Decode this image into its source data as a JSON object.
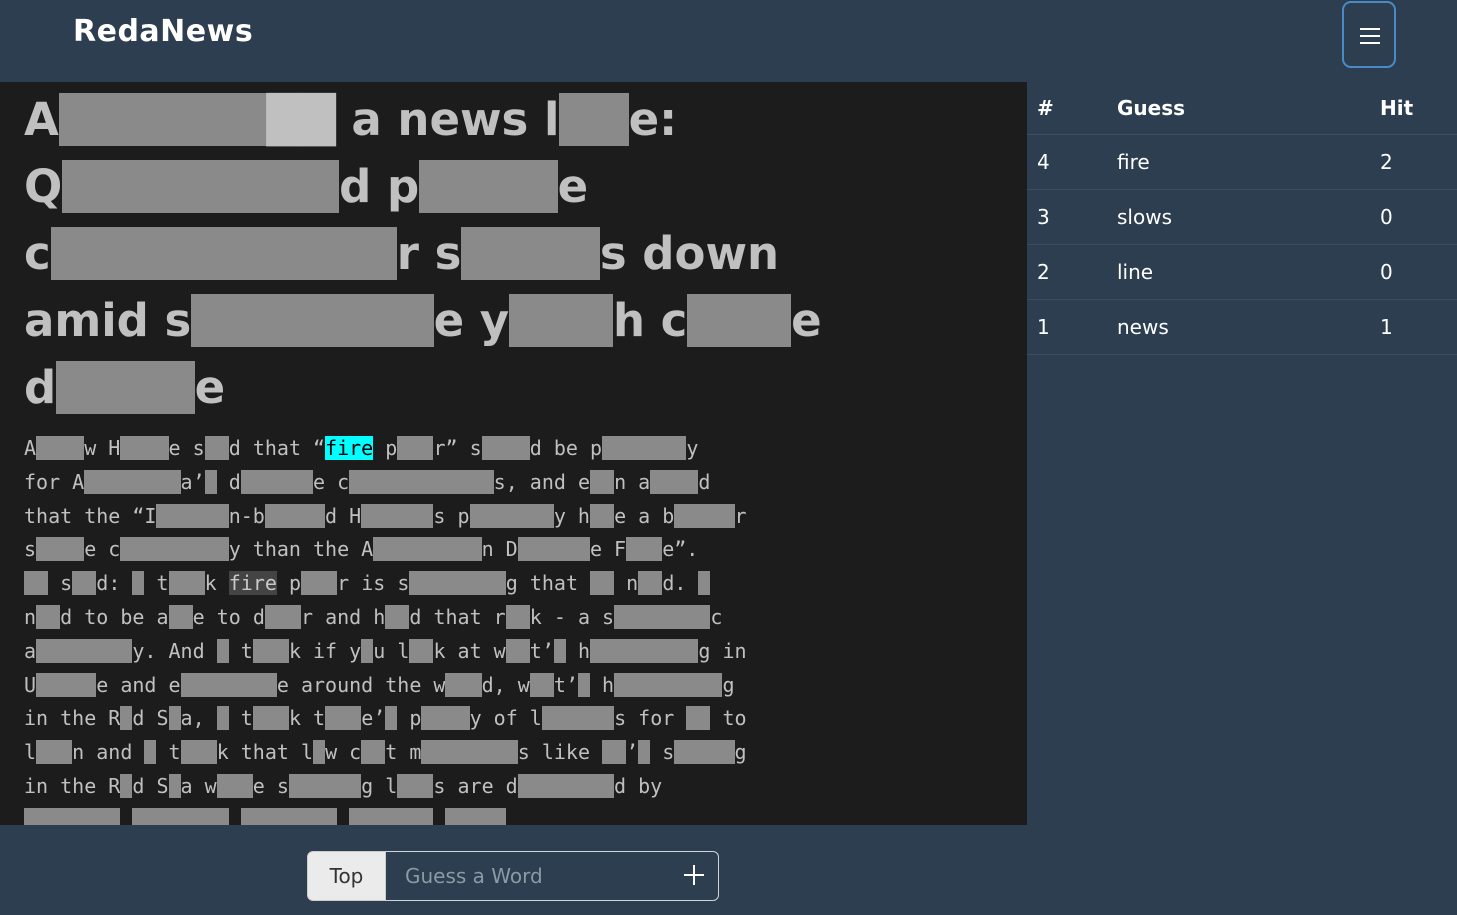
{
  "navbar": {
    "brand": "RedaNews",
    "menu_icon": "hamburger-icon"
  },
  "article": {
    "title_segments": [
      {
        "t": "A"
      },
      {
        "r": "██████"
      },
      {
        "t": "██"
      },
      {
        "t": " a news l"
      },
      {
        "r": "██"
      },
      {
        "t": "e:"
      },
      {
        "br": true
      },
      {
        "t": "Q"
      },
      {
        "r": "████████"
      },
      {
        "t": "d p"
      },
      {
        "r": "████"
      },
      {
        "t": "e"
      },
      {
        "br": true
      },
      {
        "t": "c"
      },
      {
        "r": "██████████"
      },
      {
        "t": "r s"
      },
      {
        "r": "████"
      },
      {
        "t": "s down"
      },
      {
        "br": true
      },
      {
        "t": "amid s"
      },
      {
        "r": "███████"
      },
      {
        "t": "e y"
      },
      {
        "r": "███"
      },
      {
        "t": "h c"
      },
      {
        "r": "███"
      },
      {
        "t": "e"
      },
      {
        "br": true
      },
      {
        "t": "d"
      },
      {
        "r": "████"
      },
      {
        "t": "e"
      }
    ],
    "body_segments": [
      {
        "t": "A"
      },
      {
        "r": "████"
      },
      {
        "t": "w H"
      },
      {
        "r": "████"
      },
      {
        "t": "e s"
      },
      {
        "r": "██"
      },
      {
        "t": "d that “"
      },
      {
        "hit": "fire"
      },
      {
        "t": " p"
      },
      {
        "r": "███"
      },
      {
        "t": "r” s"
      },
      {
        "r": "████"
      },
      {
        "t": "d be p"
      },
      {
        "r": "███████"
      },
      {
        "t": "y"
      },
      {
        "br": true
      },
      {
        "t": "for A"
      },
      {
        "r": "████████"
      },
      {
        "t": "a’"
      },
      {
        "r": "█"
      },
      {
        "t": " d"
      },
      {
        "r": "██████"
      },
      {
        "t": "e c"
      },
      {
        "r": "████████████"
      },
      {
        "t": "s, and e"
      },
      {
        "r": "██"
      },
      {
        "t": "n a"
      },
      {
        "r": "████"
      },
      {
        "t": "d"
      },
      {
        "br": true
      },
      {
        "t": "that the “I"
      },
      {
        "r": "██████"
      },
      {
        "t": "n-b"
      },
      {
        "r": "█████"
      },
      {
        "t": "d H"
      },
      {
        "r": "██████"
      },
      {
        "t": "s p"
      },
      {
        "r": "███████"
      },
      {
        "t": "y h"
      },
      {
        "r": "██"
      },
      {
        "t": "e a b"
      },
      {
        "r": "█████"
      },
      {
        "t": "r"
      },
      {
        "br": true
      },
      {
        "t": "s"
      },
      {
        "r": "████"
      },
      {
        "t": "e c"
      },
      {
        "r": "█████████"
      },
      {
        "t": "y than the A"
      },
      {
        "r": "█████████"
      },
      {
        "t": "n D"
      },
      {
        "r": "██████"
      },
      {
        "t": "e F"
      },
      {
        "r": "███"
      },
      {
        "t": "e”."
      },
      {
        "br": true
      },
      {
        "r": "██"
      },
      {
        "t": " s"
      },
      {
        "r": "██"
      },
      {
        "t": "d: "
      },
      {
        "r": "█"
      },
      {
        "t": " t"
      },
      {
        "r": "███"
      },
      {
        "t": "k "
      },
      {
        "old": "fire"
      },
      {
        "t": " p"
      },
      {
        "r": "███"
      },
      {
        "t": "r is s"
      },
      {
        "r": "████████"
      },
      {
        "t": "g that "
      },
      {
        "r": "██"
      },
      {
        "t": " n"
      },
      {
        "r": "██"
      },
      {
        "t": "d. "
      },
      {
        "r": "█"
      },
      {
        "br": true
      },
      {
        "t": "n"
      },
      {
        "r": "██"
      },
      {
        "t": "d to be a"
      },
      {
        "r": "██"
      },
      {
        "t": "e to d"
      },
      {
        "r": "███"
      },
      {
        "t": "r and h"
      },
      {
        "r": "██"
      },
      {
        "t": "d that r"
      },
      {
        "r": "██"
      },
      {
        "t": "k - a s"
      },
      {
        "r": "████████"
      },
      {
        "t": "c"
      },
      {
        "br": true
      },
      {
        "t": "a"
      },
      {
        "r": "████████"
      },
      {
        "t": "y. And "
      },
      {
        "r": "█"
      },
      {
        "t": " t"
      },
      {
        "r": "███"
      },
      {
        "t": "k if y"
      },
      {
        "r": "█"
      },
      {
        "t": "u l"
      },
      {
        "r": "██"
      },
      {
        "t": "k at w"
      },
      {
        "r": "██"
      },
      {
        "t": "t’"
      },
      {
        "r": "█"
      },
      {
        "t": " h"
      },
      {
        "r": "█████████"
      },
      {
        "t": "g in"
      },
      {
        "br": true
      },
      {
        "t": "U"
      },
      {
        "r": "█████"
      },
      {
        "t": "e and e"
      },
      {
        "r": "████████"
      },
      {
        "t": "e around the w"
      },
      {
        "r": "███"
      },
      {
        "t": "d, w"
      },
      {
        "r": "██"
      },
      {
        "t": "t’"
      },
      {
        "r": "█"
      },
      {
        "t": " h"
      },
      {
        "r": "█████████"
      },
      {
        "t": "g"
      },
      {
        "br": true
      },
      {
        "t": "in the R"
      },
      {
        "r": "█"
      },
      {
        "t": "d S"
      },
      {
        "r": "█"
      },
      {
        "t": "a, "
      },
      {
        "r": "█"
      },
      {
        "t": " t"
      },
      {
        "r": "███"
      },
      {
        "t": "k t"
      },
      {
        "r": "███"
      },
      {
        "t": "e’"
      },
      {
        "r": "█"
      },
      {
        "t": " p"
      },
      {
        "r": "████"
      },
      {
        "t": "y of l"
      },
      {
        "r": "██████"
      },
      {
        "t": "s for "
      },
      {
        "r": "██"
      },
      {
        "t": " to"
      },
      {
        "br": true
      },
      {
        "t": "l"
      },
      {
        "r": "███"
      },
      {
        "t": "n and "
      },
      {
        "r": "█"
      },
      {
        "t": " t"
      },
      {
        "r": "███"
      },
      {
        "t": "k that l"
      },
      {
        "r": "█"
      },
      {
        "t": "w c"
      },
      {
        "r": "██"
      },
      {
        "t": "t m"
      },
      {
        "r": "████████"
      },
      {
        "t": "s like "
      },
      {
        "r": "██"
      },
      {
        "t": "’"
      },
      {
        "r": "█"
      },
      {
        "t": " s"
      },
      {
        "r": "█████"
      },
      {
        "t": "g"
      },
      {
        "br": true
      },
      {
        "t": "in the R"
      },
      {
        "r": "█"
      },
      {
        "t": "d S"
      },
      {
        "r": "█"
      },
      {
        "t": "a w"
      },
      {
        "r": "███"
      },
      {
        "t": "e s"
      },
      {
        "r": "██████"
      },
      {
        "t": "g l"
      },
      {
        "r": "███"
      },
      {
        "t": "s are d"
      },
      {
        "r": "████████"
      },
      {
        "t": "d by"
      },
      {
        "br": true
      },
      {
        "r": "████████"
      },
      {
        "t": "   "
      },
      {
        "r": "████████"
      },
      {
        "t": "  "
      },
      {
        "r": "████████"
      },
      {
        "t": "  "
      },
      {
        "r": "███████"
      },
      {
        "t": "  "
      },
      {
        "r": "█████"
      }
    ]
  },
  "guesses": {
    "headers": {
      "num": "#",
      "guess": "Guess",
      "hit": "Hit"
    },
    "rows": [
      {
        "num": "4",
        "guess": "fire",
        "hit": "2"
      },
      {
        "num": "3",
        "guess": "slows",
        "hit": "0"
      },
      {
        "num": "2",
        "guess": "line",
        "hit": "0"
      },
      {
        "num": "1",
        "guess": "news",
        "hit": "1"
      }
    ]
  },
  "footer": {
    "top_label": "Top",
    "placeholder": "Guess a Word",
    "plus_icon": "plus-icon"
  }
}
